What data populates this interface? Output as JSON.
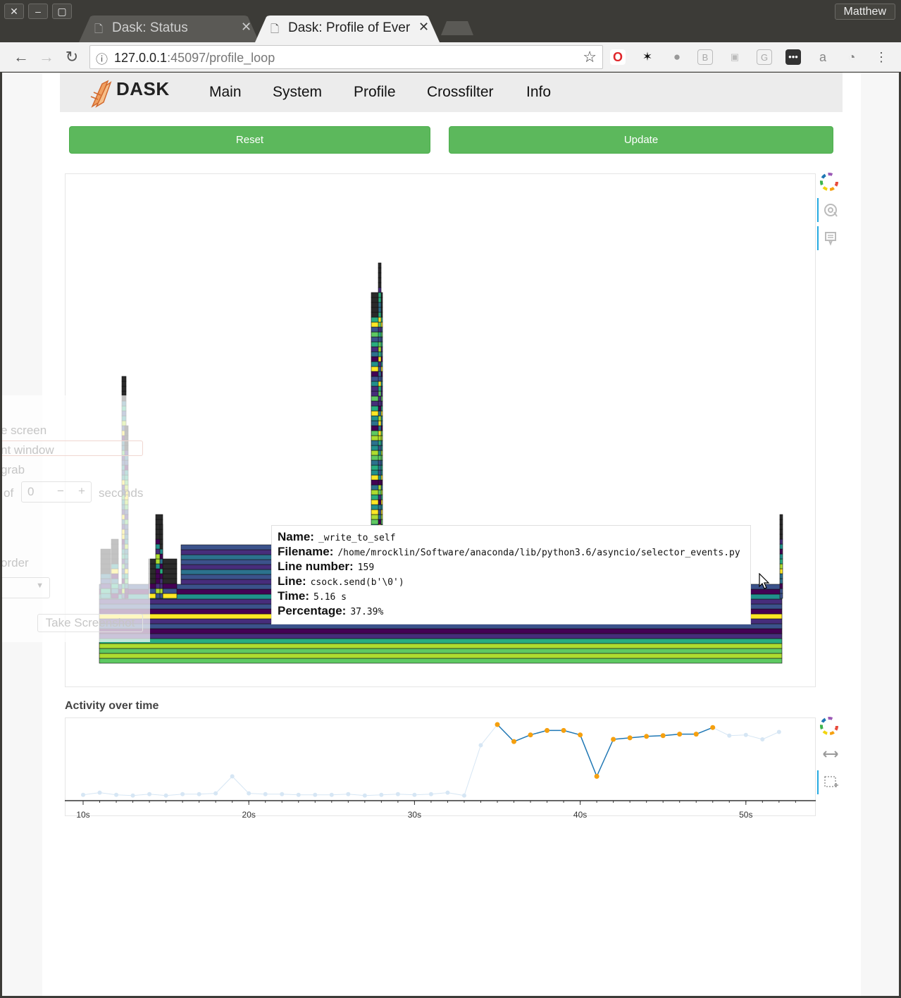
{
  "browser": {
    "user_name": "Matthew",
    "tabs": [
      {
        "title": "Dask: Status",
        "active": false
      },
      {
        "title": "Dask: Profile of Ever",
        "active": true
      }
    ],
    "url_host": "127.0.0.1",
    "url_rest": ":45097/profile_loop"
  },
  "nav": {
    "logo_text": "DASK",
    "links": [
      "Main",
      "System",
      "Profile",
      "Crossfilter",
      "Info"
    ]
  },
  "buttons": {
    "reset": "Reset",
    "update": "Update"
  },
  "tooltip": {
    "name_label": "Name:",
    "name_value": "_write_to_self",
    "filename_label": "Filename:",
    "filename_value": "/home/mrocklin/Software/anaconda/lib/python3.6/asyncio/selector_events.py",
    "line_number_label": "Line number:",
    "line_number_value": "159",
    "line_label": "Line:",
    "line_value": "csock.send(b'\\0')",
    "time_label": "Time:",
    "time_value": "5.16 s",
    "percentage_label": "Percentage:",
    "percentage_value": "37.39%"
  },
  "activity": {
    "title": "Activity over time",
    "chart_data": {
      "type": "line",
      "x_ticks": [
        "10s",
        "20s",
        "30s",
        "40s",
        "50s"
      ],
      "xlim": [
        9,
        54
      ],
      "series": [
        {
          "selected": false,
          "x": [
            10,
            11,
            12,
            13,
            14,
            15,
            16,
            17,
            18,
            19,
            20,
            21,
            22,
            23,
            24,
            25,
            26,
            27,
            28,
            29,
            30,
            31,
            32,
            33,
            34
          ],
          "y": [
            0.05,
            0.08,
            0.05,
            0.04,
            0.06,
            0.04,
            0.06,
            0.06,
            0.07,
            0.3,
            0.07,
            0.06,
            0.06,
            0.05,
            0.05,
            0.05,
            0.06,
            0.04,
            0.05,
            0.06,
            0.05,
            0.06,
            0.08,
            0.04,
            0.72
          ]
        },
        {
          "selected": true,
          "x": [
            35,
            36,
            37,
            38,
            39,
            40,
            41,
            42,
            43,
            44,
            45,
            46,
            47,
            48
          ],
          "y": [
            1.0,
            0.77,
            0.86,
            0.92,
            0.92,
            0.86,
            0.3,
            0.8,
            0.82,
            0.84,
            0.85,
            0.87,
            0.87,
            0.96
          ]
        },
        {
          "selected": false,
          "x": [
            49,
            50,
            51,
            52
          ],
          "y": [
            0.85,
            0.86,
            0.8,
            0.9
          ]
        }
      ]
    }
  },
  "colors": {
    "button_green": "#5cb85c",
    "line_blue": "#1f77b4",
    "point_orange": "#f5a00f"
  },
  "screenshot_dialog": {
    "option_screen": "e screen",
    "option_window": "nt window",
    "option_grab": "grab",
    "delay_prefix": "of",
    "delay_value": "0",
    "delay_minus": "−",
    "delay_plus": "+",
    "delay_unit": "seconds",
    "border_label": "order",
    "take_button": "Take Screenshot"
  }
}
